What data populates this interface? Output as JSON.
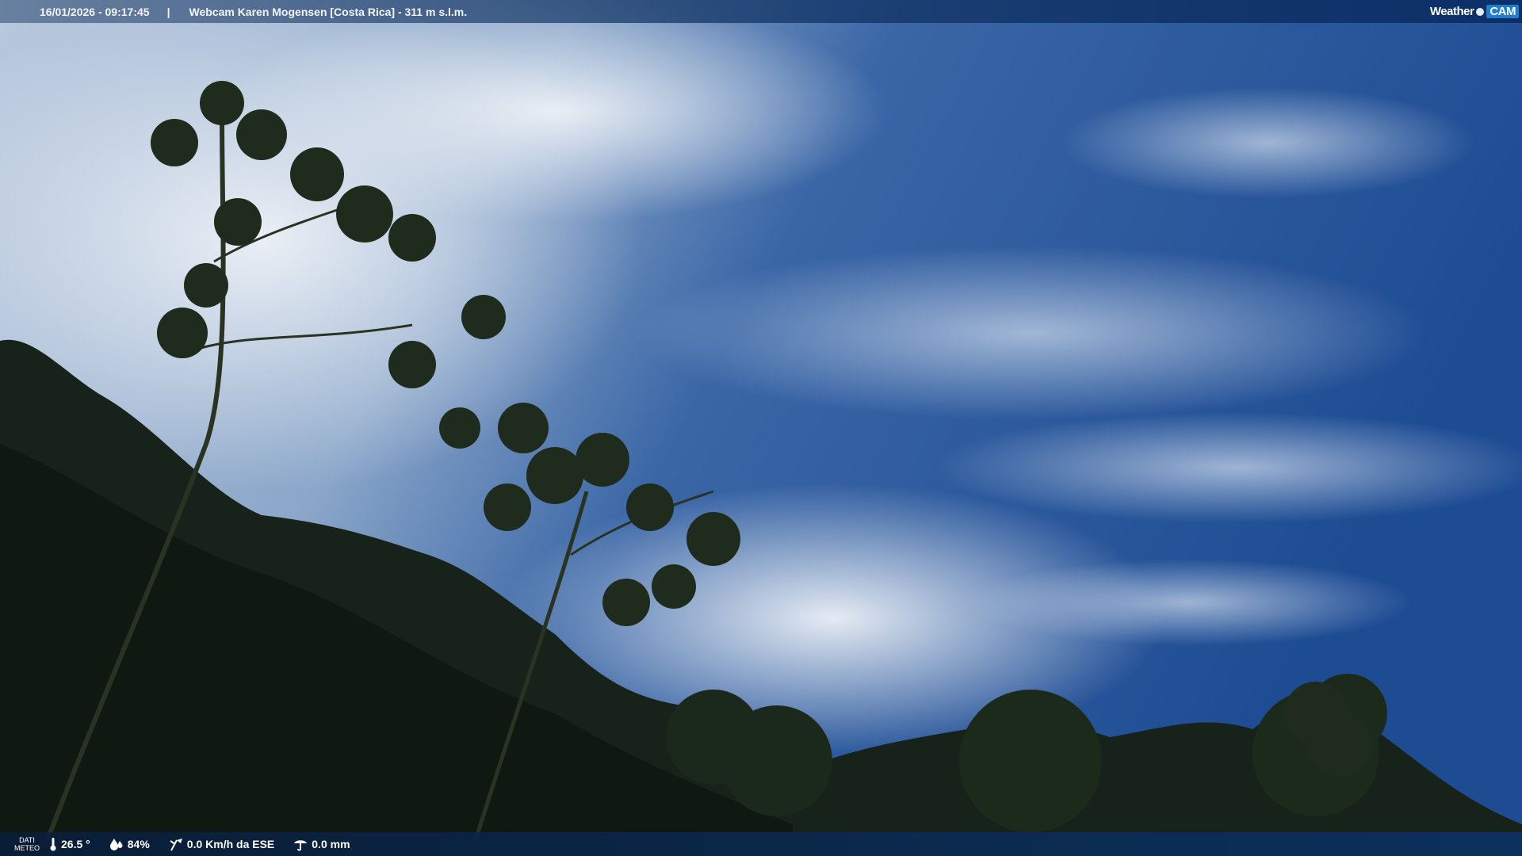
{
  "header": {
    "datetime": "16/01/2026 - 09:17:45",
    "separator": "|",
    "location": "Webcam Karen Mogensen [Costa Rica] - 311 m s.l.m."
  },
  "logo": {
    "part1": "Weather",
    "part2": "CAM"
  },
  "footer": {
    "dati_line1": "DATI",
    "dati_line2": "METEO",
    "temperature": "26.5 °",
    "humidity": "84%",
    "wind": "0.0 Km/h da ESE",
    "rain": "0.0 mm"
  },
  "colors": {
    "sky_dark": "#1f4f95",
    "sky_light": "#c9d6e6",
    "foliage": "#1c2a1a"
  },
  "icons": [
    "thermometer-icon",
    "humidity-icon",
    "wind-icon",
    "rain-gauge-icon"
  ]
}
